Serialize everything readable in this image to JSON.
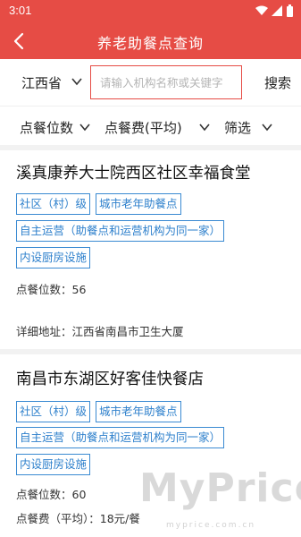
{
  "status_bar": {
    "time": "3:01"
  },
  "app_bar": {
    "title": "养老助餐点查询"
  },
  "search": {
    "province": "江西省",
    "placeholder": "请输入机构名称或关键字",
    "button": "搜索"
  },
  "filters": [
    "点餐位数",
    "点餐费(平均)",
    "筛选"
  ],
  "cards": [
    {
      "name": "溪真康养大士院西区社区幸福食堂",
      "tags": [
        "社区（村）级",
        "城市老年助餐点",
        "自主运营（助餐点和运营机构为同一家）",
        "内设厨房设施"
      ],
      "seats": "点餐位数：56",
      "address": "详细地址：江西省南昌市卫生大厦"
    },
    {
      "name": "南昌市东湖区好客佳快餐店",
      "tags": [
        "社区（村）级",
        "城市老年助餐点",
        "自主运营（助餐点和运营机构为同一家）",
        "内设厨房设施"
      ],
      "seats": "点餐位数：60",
      "fee": "点餐费（平均）：18元/餐"
    }
  ],
  "watermark": {
    "main": "MyPrice",
    "sub": "myprice.com.cn"
  },
  "colors": {
    "brand": "#e64c45",
    "tag_border": "#3a8ad2"
  },
  "icons": [
    "wifi-icon",
    "signal-icon",
    "battery-icon",
    "back-arrow-icon",
    "chevron-down-icon"
  ]
}
